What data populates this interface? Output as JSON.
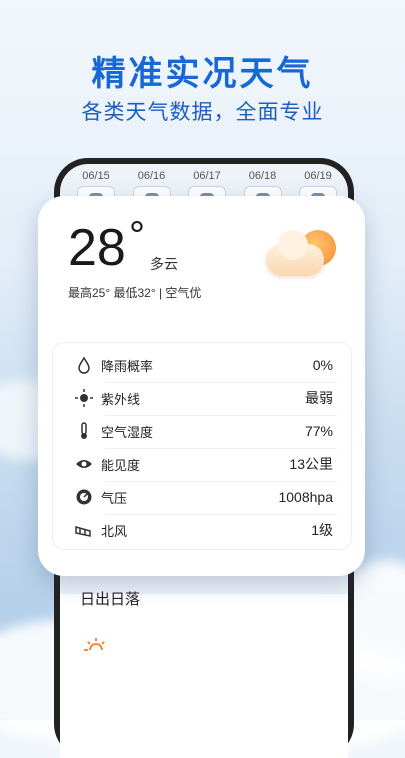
{
  "header": {
    "title": "精准实况天气",
    "subtitle": "各类天气数据，全面专业"
  },
  "forecast": [
    "06/15",
    "06/16",
    "06/17",
    "06/18",
    "06/19"
  ],
  "current": {
    "temperature": "28",
    "degree_symbol": "°",
    "condition": "多云",
    "range_text": "最高25° 最低32° | 空气优",
    "icon": "partly-cloudy-icon"
  },
  "details": [
    {
      "icon": "raindrop-icon",
      "label": "降雨概率",
      "value": "0%"
    },
    {
      "icon": "sun-uv-icon",
      "label": "紫外线",
      "value": "最弱"
    },
    {
      "icon": "thermometer-icon",
      "label": "空气湿度",
      "value": "77%"
    },
    {
      "icon": "eye-icon",
      "label": "能见度",
      "value": "13公里"
    },
    {
      "icon": "pressure-gauge-icon",
      "label": "气压",
      "value": "1008hpa"
    },
    {
      "icon": "wind-icon",
      "label": "北风",
      "value": "1级"
    }
  ],
  "sun_section": {
    "title": "日出日落",
    "icon": "sunrise-icon"
  },
  "colors": {
    "headline": "#1568d6",
    "subtitle": "#1d5fbf",
    "text": "#222222"
  }
}
